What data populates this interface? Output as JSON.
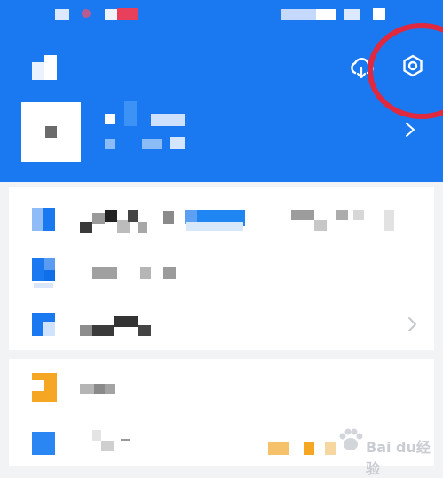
{
  "colors": {
    "header_bg": "#1a79f0",
    "page_bg": "#f2f3f5",
    "highlight_ring": "#e0283f",
    "card_bg": "#ffffff",
    "icon_blue": "#1a79f0",
    "icon_orange": "#f5a623",
    "chevron": "#c4c7cc"
  },
  "header": {
    "icons": [
      "app-logo-icon",
      "cloud-sync-icon",
      "settings-gear-icon"
    ],
    "profile_arrow_icon": "chevron-right-icon"
  },
  "menu_groups": [
    {
      "rows": [
        {
          "icon": "blue-square-icon"
        },
        {
          "icon": "blue-square-icon"
        },
        {
          "icon": "blue-flag-icon",
          "chevron": "chevron-right-icon"
        }
      ]
    },
    {
      "rows": [
        {
          "icon": "orange-square-icon"
        },
        {
          "icon": "blue-square-icon"
        }
      ]
    }
  ],
  "watermark": {
    "text": "Bai du经验"
  }
}
